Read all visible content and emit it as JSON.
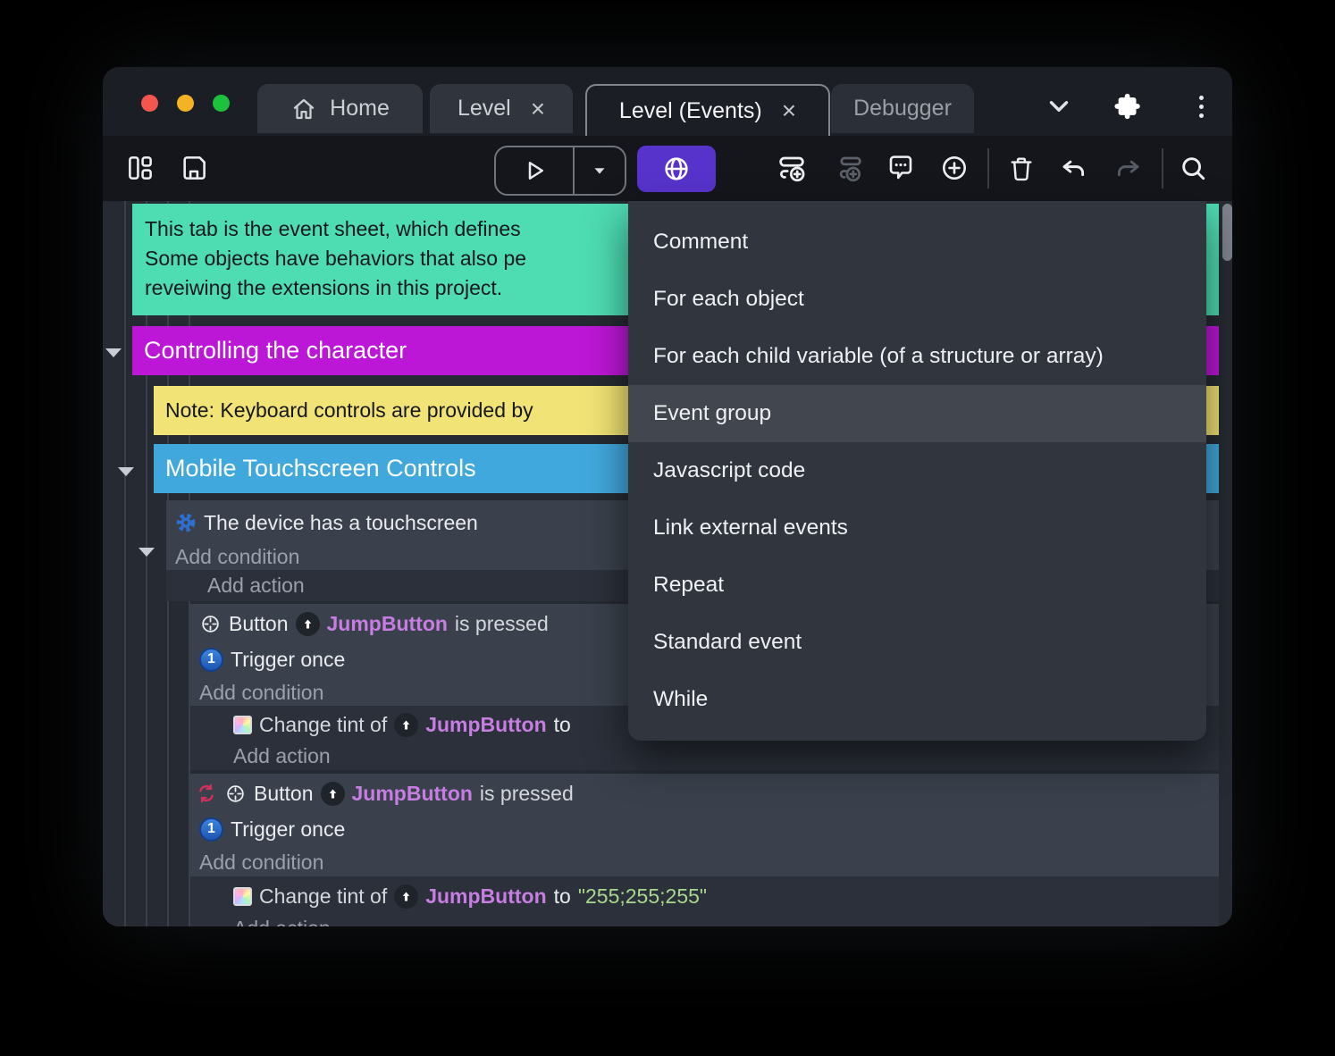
{
  "tabs": {
    "home": "Home",
    "level": "Level",
    "level_events": "Level (Events)",
    "debugger": "Debugger",
    "close_glyph": "×"
  },
  "menu": {
    "items": [
      {
        "label": "Comment"
      },
      {
        "label": "For each object"
      },
      {
        "label": "For each child variable (of a structure or array)"
      },
      {
        "label": "Event group"
      },
      {
        "label": "Javascript code"
      },
      {
        "label": "Link external events"
      },
      {
        "label": "Repeat"
      },
      {
        "label": "Standard event"
      },
      {
        "label": "While"
      }
    ],
    "highlighted_index": 3
  },
  "sheet": {
    "comment_lines": [
      "This tab is the event sheet, which defines",
      "Some objects have behaviors that also pe",
      "reveiwing the extensions in this project."
    ],
    "group_controlling": "Controlling the character",
    "note": "Note: Keyboard controls are provided by",
    "group_mobile": "Mobile Touchscreen Controls",
    "touchscreen_condition": "The device has a touchscreen",
    "add_condition": "Add condition",
    "add_action": "Add action",
    "button_label": "Button",
    "object_name": "JumpButton",
    "is_pressed": "is pressed",
    "trigger_once": "Trigger once",
    "change_tint": "Change tint of",
    "to_word": "to",
    "tint_value": "\"255;255;255\""
  },
  "colors": {
    "accent_purple": "#5733cb",
    "comment_green": "#4edcb2",
    "group_magenta": "#bc17d6",
    "note_yellow": "#f1e375",
    "group_blue": "#41a8dd",
    "object_purple": "#c77de2",
    "value_green": "#a8d78e",
    "trigger_blue": "#2d6cd4",
    "invert_red": "#d23059"
  }
}
